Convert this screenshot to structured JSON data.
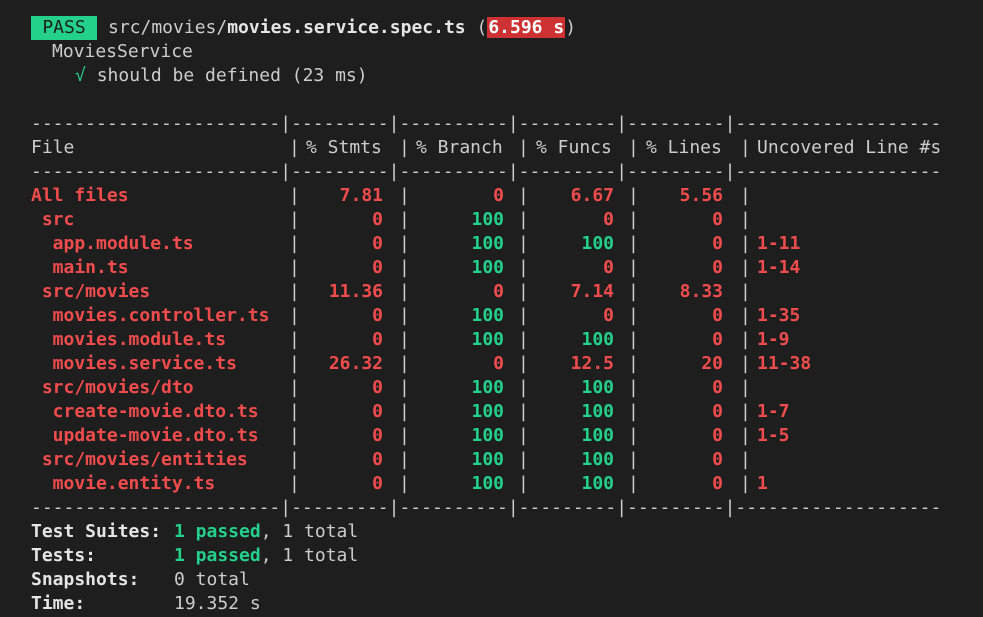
{
  "header": {
    "status": "PASS",
    "path_prefix": "src/movies/",
    "filename": "movies.service.spec.ts",
    "open_paren": " (",
    "duration": "6.596 s",
    "close_paren": ")",
    "suite_name": "MoviesService",
    "check_mark": "√",
    "test_name": "should be defined (23 ms)"
  },
  "table": {
    "columns": [
      "File",
      "% Stmts",
      "% Branch",
      "% Funcs",
      "% Lines",
      "Uncovered Line #s"
    ],
    "rows": [
      {
        "file": "All files",
        "stmts": "7.81",
        "branch": "0",
        "funcs": "6.67",
        "lines": "5.56",
        "uncovered": ""
      },
      {
        "file": " src",
        "stmts": "0",
        "branch": "100",
        "funcs": "0",
        "lines": "0",
        "uncovered": ""
      },
      {
        "file": "  app.module.ts",
        "stmts": "0",
        "branch": "100",
        "funcs": "100",
        "lines": "0",
        "uncovered": "1-11"
      },
      {
        "file": "  main.ts",
        "stmts": "0",
        "branch": "100",
        "funcs": "0",
        "lines": "0",
        "uncovered": "1-14"
      },
      {
        "file": " src/movies",
        "stmts": "11.36",
        "branch": "0",
        "funcs": "7.14",
        "lines": "8.33",
        "uncovered": ""
      },
      {
        "file": "  movies.controller.ts",
        "stmts": "0",
        "branch": "100",
        "funcs": "0",
        "lines": "0",
        "uncovered": "1-35"
      },
      {
        "file": "  movies.module.ts",
        "stmts": "0",
        "branch": "100",
        "funcs": "100",
        "lines": "0",
        "uncovered": "1-9"
      },
      {
        "file": "  movies.service.ts",
        "stmts": "26.32",
        "branch": "0",
        "funcs": "12.5",
        "lines": "20",
        "uncovered": "11-38"
      },
      {
        "file": " src/movies/dto",
        "stmts": "0",
        "branch": "100",
        "funcs": "100",
        "lines": "0",
        "uncovered": ""
      },
      {
        "file": "  create-movie.dto.ts",
        "stmts": "0",
        "branch": "100",
        "funcs": "100",
        "lines": "0",
        "uncovered": "1-7"
      },
      {
        "file": "  update-movie.dto.ts",
        "stmts": "0",
        "branch": "100",
        "funcs": "100",
        "lines": "0",
        "uncovered": "1-5"
      },
      {
        "file": " src/movies/entities",
        "stmts": "0",
        "branch": "100",
        "funcs": "100",
        "lines": "0",
        "uncovered": ""
      },
      {
        "file": "  movie.entity.ts",
        "stmts": "0",
        "branch": "100",
        "funcs": "100",
        "lines": "0",
        "uncovered": "1"
      }
    ]
  },
  "summary": {
    "suites_label": "Test Suites:",
    "suites_passed": "1 passed",
    "suites_total": ", 1 total",
    "tests_label": "Tests:",
    "tests_passed": "1 passed",
    "tests_total": ", 1 total",
    "snapshots_label": "Snapshots:",
    "snapshots_value": "0 total",
    "time_label": "Time:",
    "time_value": "19.352 s"
  },
  "colors": {
    "background": "#1e1e1e",
    "text": "#cccccc",
    "red": "#f14c4c",
    "green": "#23d18b",
    "pass_badge": "#23d18b",
    "time_badge": "#cd3131"
  }
}
